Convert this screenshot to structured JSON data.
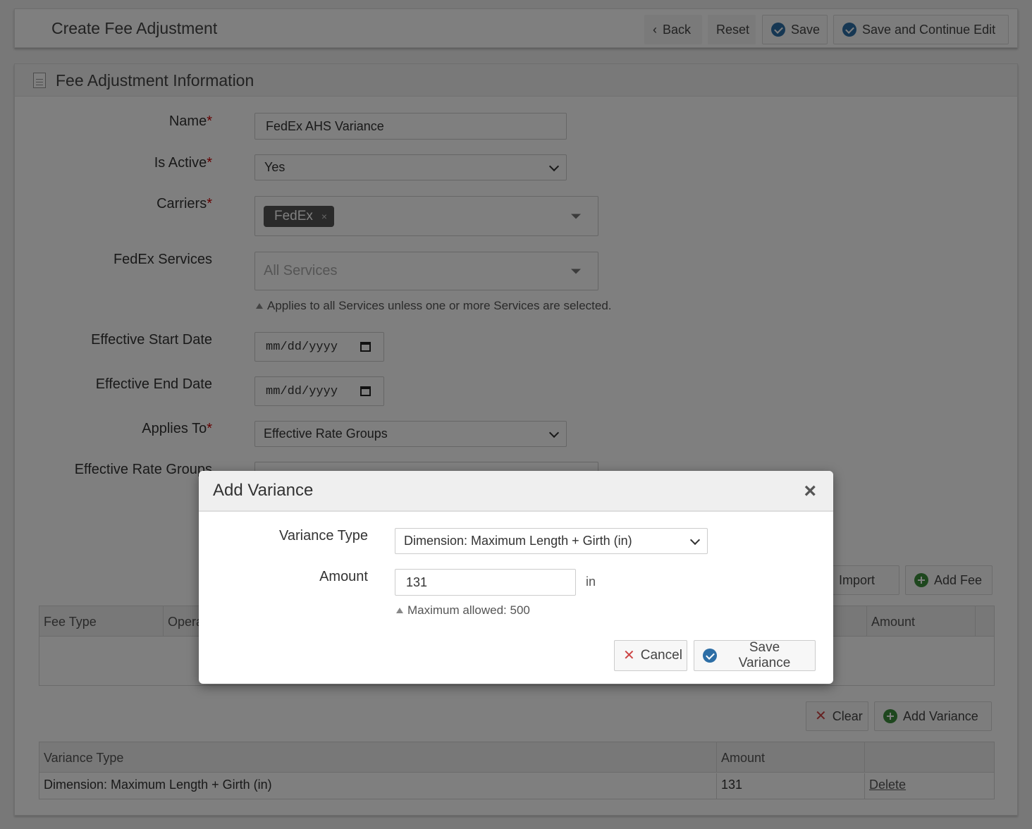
{
  "header": {
    "title": "Create Fee Adjustment",
    "back_label": "Back",
    "reset_label": "Reset",
    "save_label": "Save",
    "save_continue_label": "Save and Continue Edit"
  },
  "panel": {
    "title": "Fee Adjustment Information"
  },
  "form": {
    "name": {
      "label": "Name",
      "required": "*",
      "value": "FedEx AHS Variance"
    },
    "is_active": {
      "label": "Is Active",
      "required": "*",
      "value": "Yes"
    },
    "carriers": {
      "label": "Carriers",
      "required": "*",
      "tag": "FedEx",
      "tag_remove": "×"
    },
    "services": {
      "label": "FedEx Services",
      "placeholder": "All Services",
      "hint": "Applies to all Services unless one or more Services are selected."
    },
    "start_date": {
      "label": "Effective Start Date",
      "placeholder": "mm/dd/yyyy"
    },
    "end_date": {
      "label": "Effective End Date",
      "placeholder": "mm/dd/yyyy"
    },
    "applies_to": {
      "label": "Applies To",
      "required": "*",
      "value": "Effective Rate Groups"
    },
    "rate_groups": {
      "label": "Effective Rate Groups"
    }
  },
  "fees": {
    "import_label": "Import",
    "add_fee_label": "Add Fee",
    "columns": [
      "Fee Type",
      "Operator",
      "Amount"
    ]
  },
  "variances": {
    "clear_label": "Clear",
    "add_variance_label": "Add Variance",
    "columns": [
      "Variance Type",
      "Amount",
      ""
    ],
    "rows": [
      {
        "type": "Dimension: Maximum Length + Girth (in)",
        "amount": "131",
        "action": "Delete"
      }
    ]
  },
  "modal": {
    "title": "Add Variance",
    "close": "×",
    "variance_type_label": "Variance Type",
    "variance_type_value": "Dimension: Maximum Length + Girth (in)",
    "amount_label": "Amount",
    "amount_value": "131",
    "amount_unit": "in",
    "amount_hint": "Maximum allowed: 500",
    "cancel_label": "Cancel",
    "save_label": "Save Variance"
  },
  "colors": {
    "primary": "#2d6ea6",
    "success": "#3c8f3c",
    "danger": "#c44444",
    "required": "#cc0000"
  }
}
